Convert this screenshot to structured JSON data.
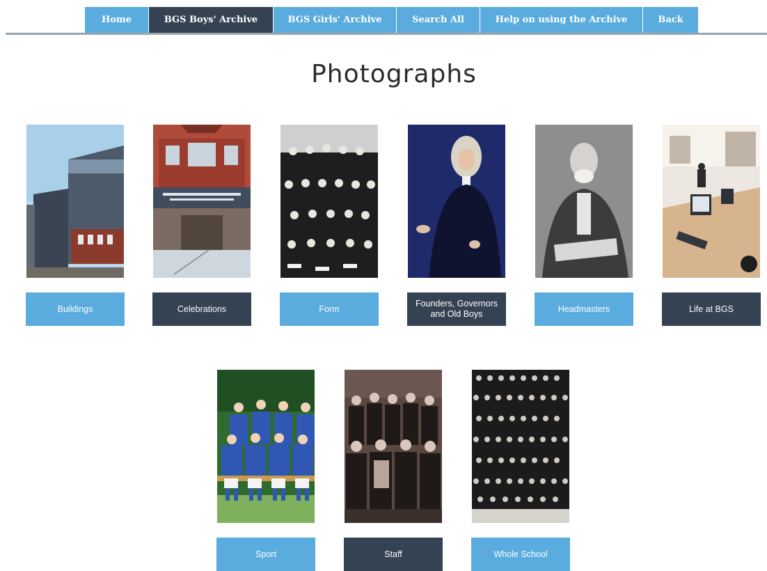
{
  "nav": {
    "items": [
      {
        "label": "Home"
      },
      {
        "label": "BGS Boys' Archive"
      },
      {
        "label": "BGS Girls' Archive"
      },
      {
        "label": "Search All"
      },
      {
        "label": "Help on using the Archive"
      },
      {
        "label": "Back"
      }
    ],
    "active_index": 1
  },
  "page": {
    "title": "Photographs"
  },
  "tiles": [
    {
      "label": "Buildings",
      "image": "buildings-photo",
      "style": "blue"
    },
    {
      "label": "Celebrations",
      "image": "celebrations-photo",
      "style": "dark"
    },
    {
      "label": "Form",
      "image": "form-photo",
      "style": "blue"
    },
    {
      "label": "Founders, Governors and Old Boys",
      "image": "founders-portrait",
      "style": "dark"
    },
    {
      "label": "Headmasters",
      "image": "headmaster-portrait",
      "style": "blue"
    },
    {
      "label": "Life at BGS",
      "image": "computer-room-photo",
      "style": "dark"
    },
    {
      "label": "Sport",
      "image": "sport-team-photo",
      "style": "blue"
    },
    {
      "label": "Staff",
      "image": "staff-photo",
      "style": "dark"
    },
    {
      "label": "Whole School",
      "image": "whole-school-photo",
      "style": "blue"
    }
  ],
  "colors": {
    "accent_blue": "#5aacdf",
    "accent_dark": "#354252",
    "divider": "#9aa5ae"
  }
}
